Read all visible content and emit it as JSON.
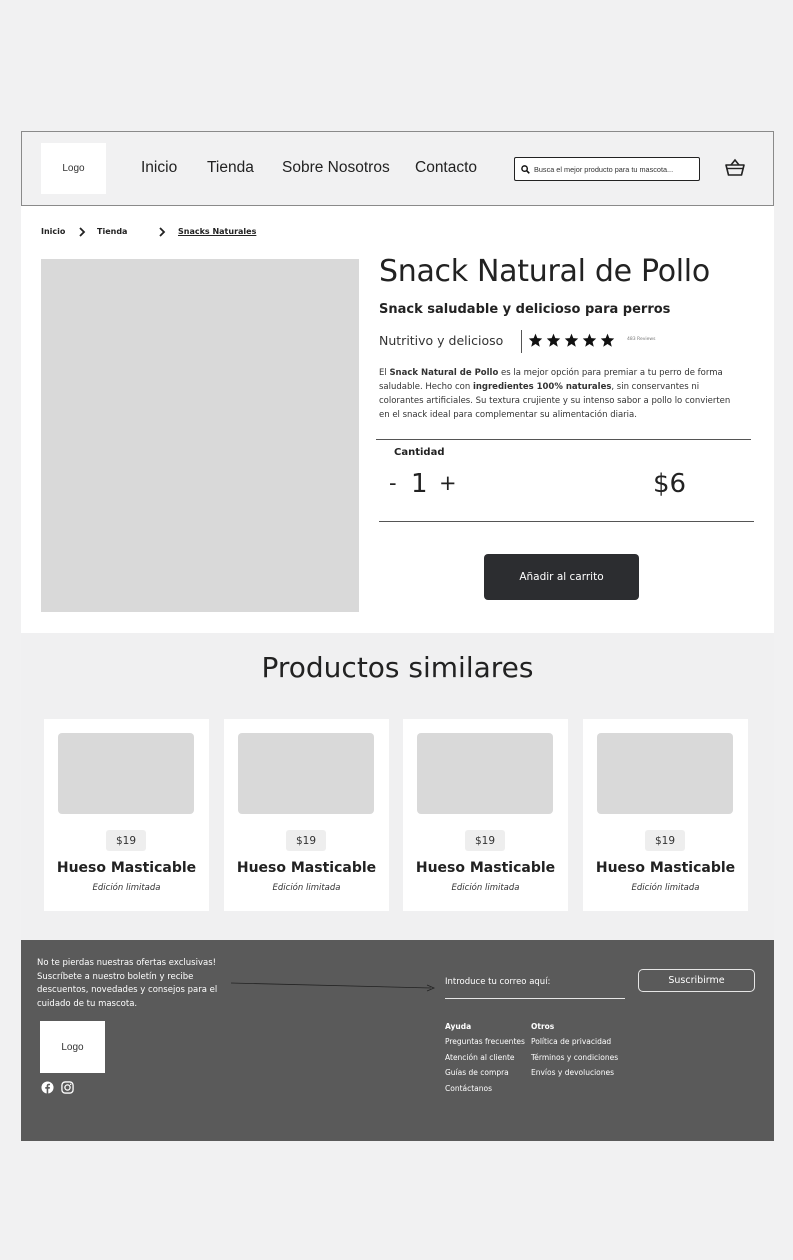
{
  "header": {
    "logo": "Logo",
    "nav": [
      "Inicio",
      "Tienda",
      "Sobre Nosotros",
      "Contacto"
    ],
    "search_placeholder": "Busca el mejor producto para tu mascota..."
  },
  "breadcrumb": [
    "Inicio",
    "Tienda",
    "Snacks Naturales"
  ],
  "product": {
    "title": "Snack Natural de Pollo",
    "subtitle": "Snack saludable y delicioso para perros",
    "tagline": "Nutritivo y delicioso",
    "rating": 5,
    "reviews": "483 Reviews",
    "description": {
      "p1": "El ",
      "b1": "Snack Natural de Pollo",
      "p2": " es la mejor opción para premiar a tu perro de forma saludable. Hecho con ",
      "b2": "ingredientes 100% naturales",
      "p3": ", sin conservantes ni colorantes artificiales. Su textura crujiente y su intenso sabor a pollo lo convierten en el snack ideal para complementar su alimentación diaria."
    },
    "quantity_label": "Cantidad",
    "minus": "-",
    "quantity": "1",
    "plus": "+",
    "price": "$6",
    "add_to_cart": "Añadir al carrito"
  },
  "similar": {
    "heading": "Productos similares",
    "items": [
      {
        "price": "$19",
        "name": "Hueso Masticable",
        "edition": "Edición limitada"
      },
      {
        "price": "$19",
        "name": "Hueso Masticable",
        "edition": "Edición limitada"
      },
      {
        "price": "$19",
        "name": "Hueso Masticable",
        "edition": "Edición limitada"
      },
      {
        "price": "$19",
        "name": "Hueso Masticable",
        "edition": "Edición limitada"
      }
    ]
  },
  "footer": {
    "promo": "No te pierdas nuestras ofertas exclusivas! Suscríbete a nuestro boletín y recibe descuentos, novedades y consejos para el cuidado de tu mascota.",
    "email_label": "Introduce tu correo aquí:",
    "subscribe": "Suscribirme",
    "logo": "Logo",
    "columns": [
      {
        "title": "Ayuda",
        "links": [
          "Preguntas frecuentes",
          "Atención al cliente",
          "Guías de compra",
          "Contáctanos"
        ]
      },
      {
        "title": "Otros",
        "links": [
          "Política de privacidad",
          "Términos y condiciones",
          "Envíos y devoluciones"
        ]
      }
    ],
    "social_icons": [
      "facebook-icon",
      "instagram-icon"
    ]
  },
  "colors": {
    "background": "#f1f1f2",
    "placeholder_gray": "#d9d9d9",
    "button_dark": "#2c2d30",
    "footer_bg": "#5a5a5a"
  }
}
